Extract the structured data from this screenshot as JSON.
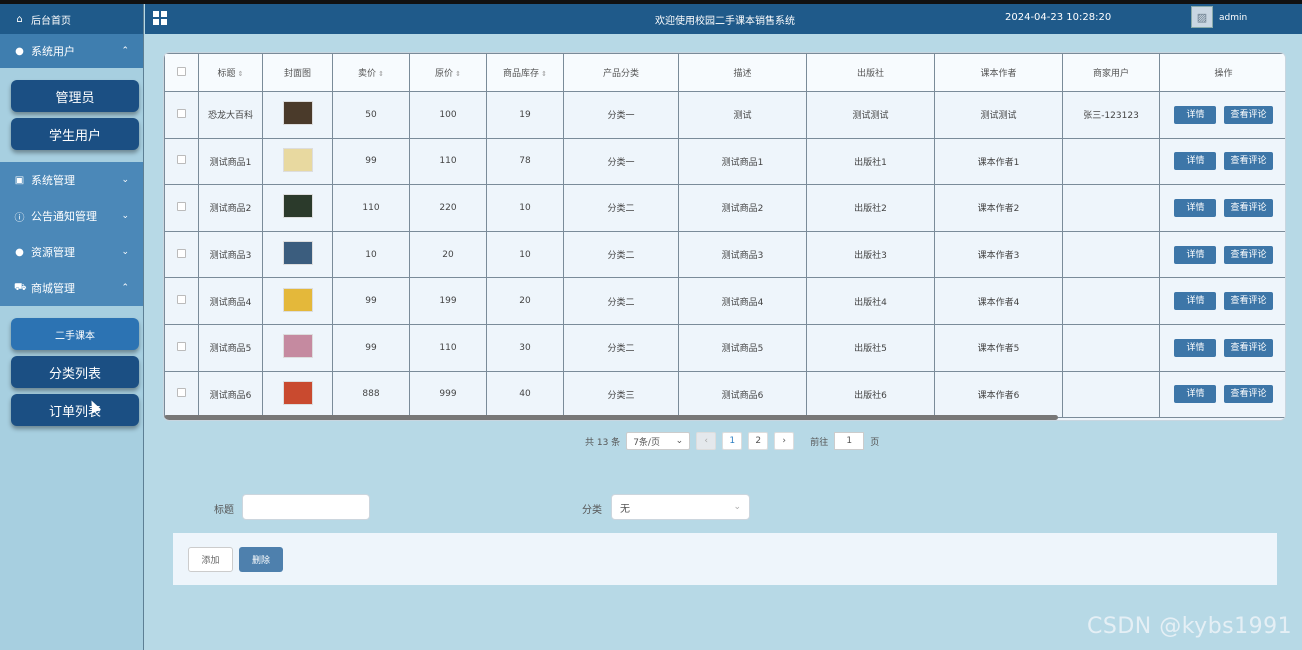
{
  "header": {
    "title": "欢迎使用校园二手课本销售系统",
    "datetime": "2024-04-23 10:28:20",
    "user": "admin"
  },
  "sidebar": {
    "home": "后台首页",
    "groups": [
      {
        "label": "系统用户",
        "icon": "user-icon",
        "expanded": true,
        "children": [
          "管理员",
          "学生用户"
        ]
      },
      {
        "label": "系统管理",
        "icon": "image-icon",
        "expanded": false
      },
      {
        "label": "公告通知管理",
        "icon": "info-icon",
        "expanded": false
      },
      {
        "label": "资源管理",
        "icon": "location-icon",
        "expanded": false
      },
      {
        "label": "商城管理",
        "icon": "cart-icon",
        "expanded": true,
        "children": [
          "二手课本",
          "分类列表",
          "订单列表"
        ]
      }
    ]
  },
  "table": {
    "columns": [
      "标题",
      "封面图",
      "卖价",
      "原价",
      "商品库存",
      "产品分类",
      "描述",
      "出版社",
      "课本作者",
      "商家用户",
      "操作"
    ],
    "rows": [
      {
        "title": "恐龙大百科",
        "price": "50",
        "original": "100",
        "stock": "19",
        "category": "分类一",
        "desc": "测试",
        "publisher": "测试测试",
        "author": "测试测试",
        "merchant": "张三-123123",
        "thumb": "#4a3a2a"
      },
      {
        "title": "测试商品1",
        "price": "99",
        "original": "110",
        "stock": "78",
        "category": "分类一",
        "desc": "测试商品1",
        "publisher": "出版社1",
        "author": "课本作者1",
        "merchant": "",
        "thumb": "#e8d9a0"
      },
      {
        "title": "测试商品2",
        "price": "110",
        "original": "220",
        "stock": "10",
        "category": "分类二",
        "desc": "测试商品2",
        "publisher": "出版社2",
        "author": "课本作者2",
        "merchant": "",
        "thumb": "#2b3a2b"
      },
      {
        "title": "测试商品3",
        "price": "10",
        "original": "20",
        "stock": "10",
        "category": "分类二",
        "desc": "测试商品3",
        "publisher": "出版社3",
        "author": "课本作者3",
        "merchant": "",
        "thumb": "#3b5d7e"
      },
      {
        "title": "测试商品4",
        "price": "99",
        "original": "199",
        "stock": "20",
        "category": "分类二",
        "desc": "测试商品4",
        "publisher": "出版社4",
        "author": "课本作者4",
        "merchant": "",
        "thumb": "#e4b83a"
      },
      {
        "title": "测试商品5",
        "price": "99",
        "original": "110",
        "stock": "30",
        "category": "分类二",
        "desc": "测试商品5",
        "publisher": "出版社5",
        "author": "课本作者5",
        "merchant": "",
        "thumb": "#c58aa0"
      },
      {
        "title": "测试商品6",
        "price": "888",
        "original": "999",
        "stock": "40",
        "category": "分类三",
        "desc": "测试商品6",
        "publisher": "出版社6",
        "author": "课本作者6",
        "merchant": "",
        "thumb": "#c94a2f"
      }
    ],
    "detail_label": "详情",
    "comment_label": "查看评论"
  },
  "pagination": {
    "total": "共 13 条",
    "page_size": "7条/页",
    "pages": [
      "1",
      "2"
    ],
    "current": "1",
    "goto_label": "前往",
    "goto_value": "1",
    "page_suffix": "页"
  },
  "search": {
    "title_label": "标题",
    "title_value": "",
    "category_label": "分类",
    "category_value": "无"
  },
  "actions": {
    "add": "添加",
    "delete": "删除"
  },
  "watermark": "CSDN @kybs1991"
}
